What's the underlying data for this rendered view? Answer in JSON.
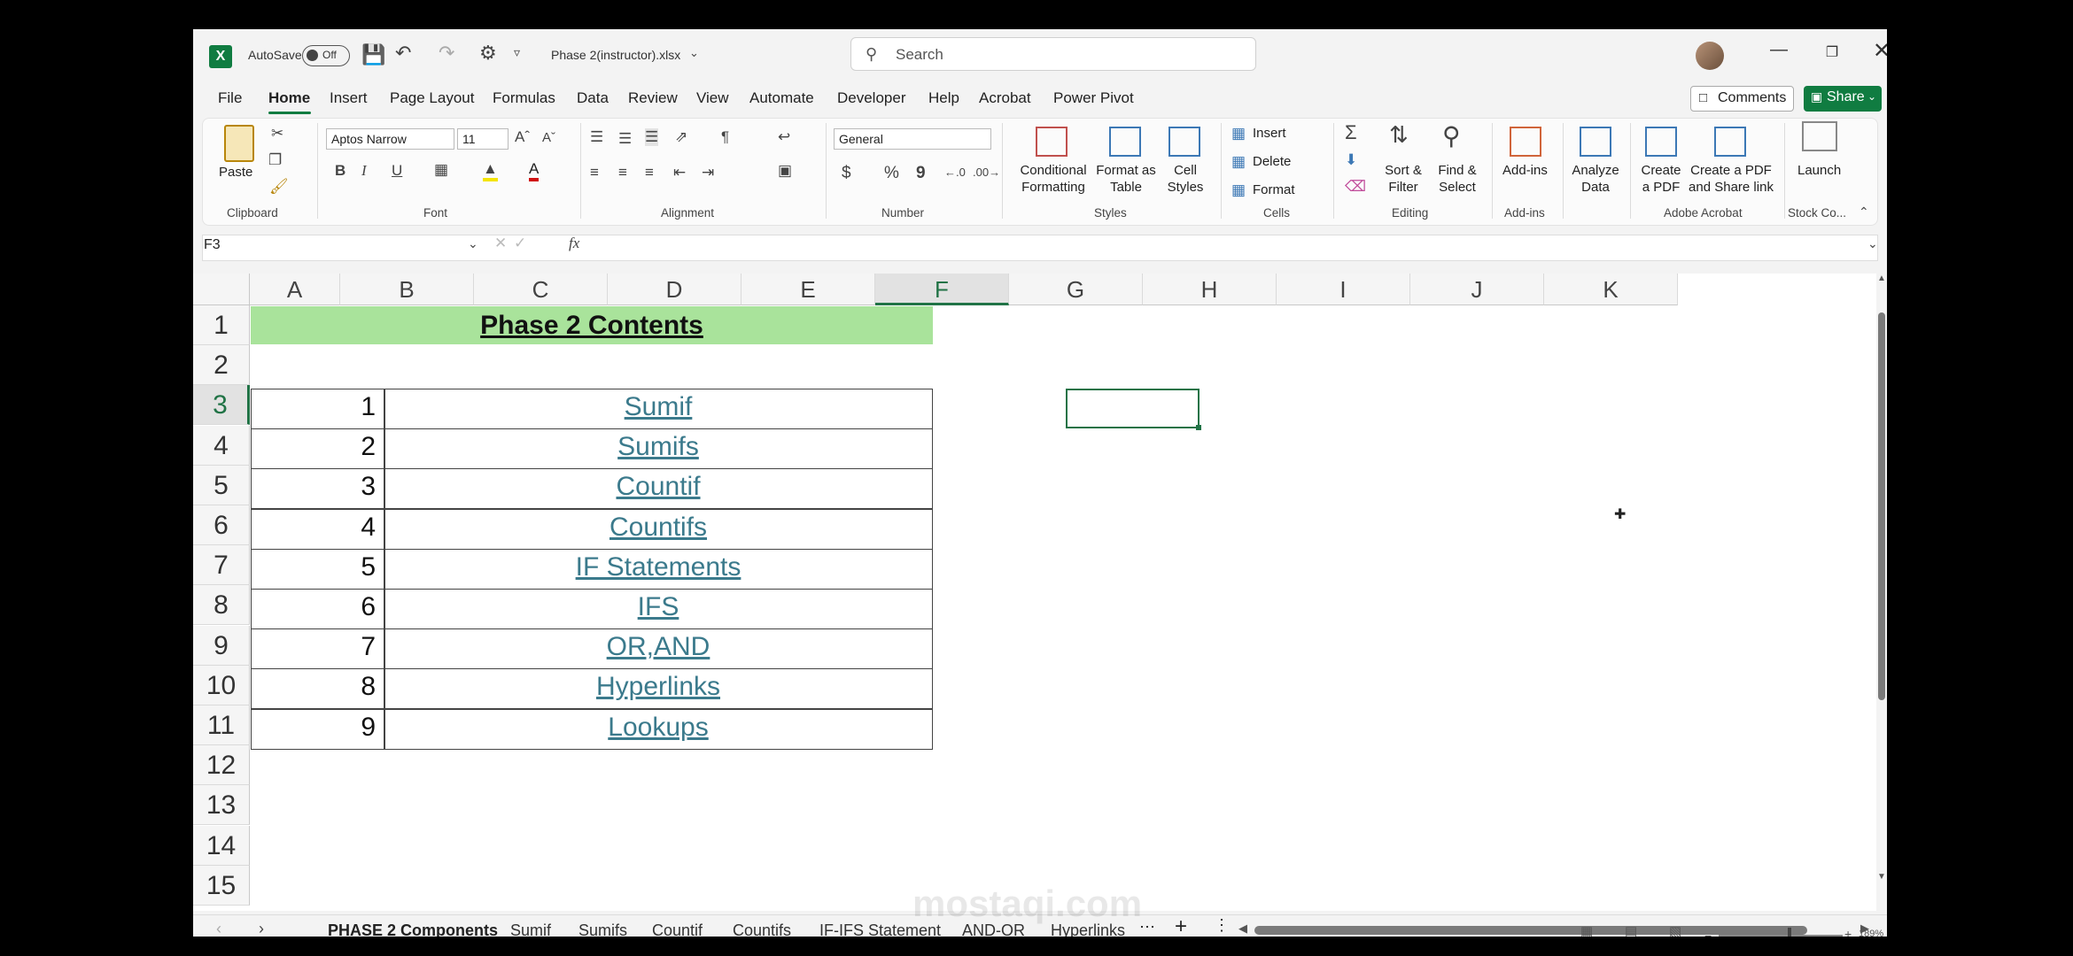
{
  "titlebar": {
    "autosave_label": "AutoSave",
    "autosave_state": "Off",
    "filename": "Phase 2(instructor).xlsx",
    "search_placeholder": "Search"
  },
  "menu": [
    "File",
    "Home",
    "Insert",
    "Page Layout",
    "Formulas",
    "Data",
    "Review",
    "View",
    "Automate",
    "Developer",
    "Help",
    "Acrobat",
    "Power Pivot"
  ],
  "buttons": {
    "comments": "Comments",
    "share": "Share"
  },
  "ribbon": {
    "clipboard": {
      "paste": "Paste",
      "group": "Clipboard"
    },
    "font": {
      "name": "Aptos Narrow",
      "size": "11",
      "bold": "B",
      "italic": "I",
      "underline": "U",
      "group": "Font"
    },
    "alignment": {
      "group": "Alignment"
    },
    "number": {
      "format": "General",
      "currency": "$",
      "percent": "%",
      "comma": "9",
      "group": "Number"
    },
    "styles": {
      "conditional": "Conditional",
      "conditional2": "Formatting",
      "format_table": "Format as",
      "format_table2": "Table",
      "cell_styles": "Cell",
      "cell_styles2": "Styles",
      "group": "Styles"
    },
    "cells": {
      "insert": "Insert",
      "delete": "Delete",
      "format": "Format",
      "group": "Cells"
    },
    "editing": {
      "sort": "Sort &",
      "sort2": "Filter",
      "find": "Find &",
      "find2": "Select",
      "group": "Editing"
    },
    "addins": {
      "label": "Add-ins",
      "group": "Add-ins"
    },
    "analyze": {
      "label": "Analyze",
      "label2": "Data"
    },
    "acrobat": {
      "create": "Create",
      "create2": "a PDF",
      "share": "Create a PDF",
      "share2": "and Share link",
      "group": "Adobe Acrobat"
    },
    "stock": {
      "label": "Launch",
      "group": "Stock Co..."
    }
  },
  "formula_bar": {
    "name_box": "F3",
    "fx": "fx",
    "value": ""
  },
  "columns": [
    "A",
    "B",
    "C",
    "D",
    "E",
    "F",
    "G",
    "H",
    "I",
    "J",
    "K"
  ],
  "selected_column": "F",
  "rows": [
    "1",
    "2",
    "3",
    "4",
    "5",
    "6",
    "7",
    "8",
    "9",
    "10",
    "11",
    "12",
    "13",
    "14",
    "15"
  ],
  "selected_row": "3",
  "sheet": {
    "title": "Phase 2 Contents",
    "items": [
      {
        "num": "1",
        "name": "Sumif"
      },
      {
        "num": "2",
        "name": "Sumifs"
      },
      {
        "num": "3",
        "name": "Countif"
      },
      {
        "num": "4",
        "name": "Countifs"
      },
      {
        "num": "5",
        "name": "IF Statements"
      },
      {
        "num": "6",
        "name": "IFS"
      },
      {
        "num": "7",
        "name": "OR,AND"
      },
      {
        "num": "8",
        "name": "Hyperlinks"
      },
      {
        "num": "9",
        "name": "Lookups"
      }
    ]
  },
  "sheet_tabs": [
    "PHASE 2 Components",
    "Sumif",
    "Sumifs",
    "Countif",
    "Countifs",
    "IF-IFS Statement",
    "AND-OR",
    "Hyperlinks"
  ],
  "status": {
    "zoom": "189%"
  },
  "watermark": "mostaqi.com"
}
